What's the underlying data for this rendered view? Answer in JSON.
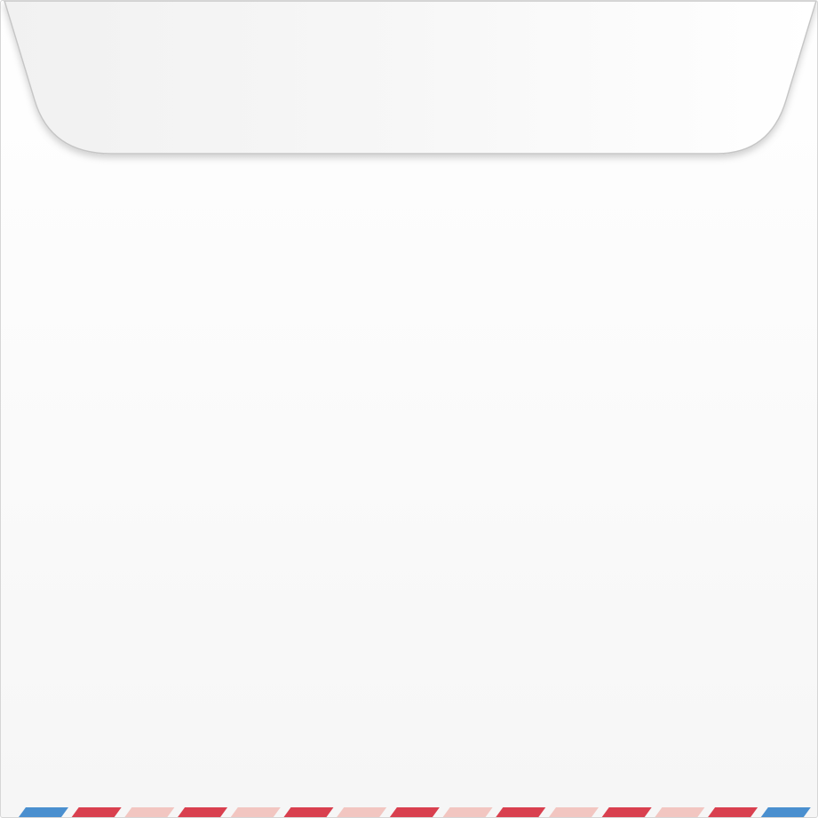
{
  "envelope": {
    "colors": {
      "paper": "#fafafa",
      "flap_top": "#f2f2f2",
      "flap_edge": "#c9c9c9",
      "outline": "#d6d6d6"
    }
  },
  "airmail_border": {
    "pattern": [
      "blue",
      "red",
      "pink",
      "red",
      "pink",
      "red",
      "pink",
      "red",
      "pink",
      "red",
      "pink",
      "red",
      "pink",
      "red",
      "blue"
    ],
    "colors": {
      "blue": "#4a8fcf",
      "red": "#d9404f",
      "pink": "#f2c6c1"
    }
  }
}
